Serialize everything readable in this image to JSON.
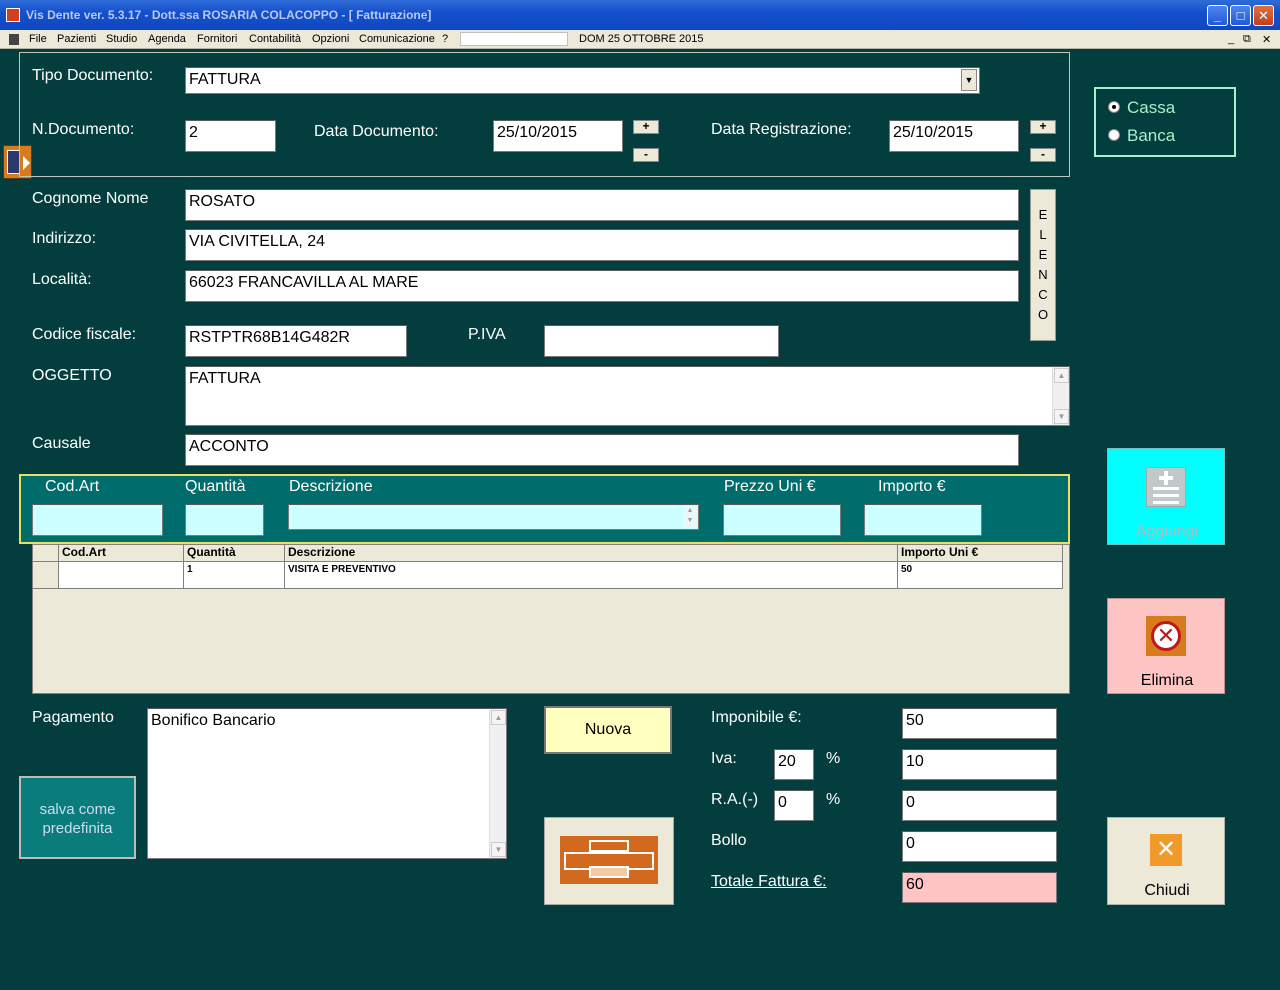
{
  "window": {
    "title": "Vis Dente ver. 5.3.17 - Dott.ssa ROSARIA COLACOPPO - [ Fatturazione]",
    "controls": {
      "minimize": "_",
      "maximize": "□",
      "close": "✕"
    }
  },
  "menu": {
    "items": [
      "File",
      "Pazienti",
      "Studio",
      "Agenda",
      "Fornitori",
      "Contabilità",
      "Opzioni",
      "Comunicazione",
      "?"
    ],
    "date": "DOM 25 OTTOBRE 2015",
    "mdi": {
      "minimize": "_",
      "restore": "⧉",
      "close": "✕"
    }
  },
  "document": {
    "tipo_label": "Tipo Documento:",
    "tipo_value": "FATTURA",
    "numero_label": "N.Documento:",
    "numero_value": "2",
    "data_doc_label": "Data Documento:",
    "data_doc_value": "25/10/2015",
    "data_reg_label": "Data Registrazione:",
    "data_reg_value": "25/10/2015",
    "plus": "+",
    "minus": "-"
  },
  "payment_mode": {
    "options": [
      "Cassa",
      "Banca"
    ],
    "selected": "Cassa"
  },
  "client": {
    "cognome_label": "Cognome Nome",
    "cognome_value": "ROSATO",
    "indirizzo_label": "Indirizzo:",
    "indirizzo_value": "VIA CIVITELLA, 24",
    "localita_label": "Località:",
    "localita_value": "66023 FRANCAVILLA AL MARE",
    "cf_label": "Codice fiscale:",
    "cf_value": "RSTPTR68B14G482R",
    "piva_label": "P.IVA",
    "piva_value": "",
    "elenco_letters": [
      "E",
      "L",
      "E",
      "N",
      "C",
      "O"
    ]
  },
  "oggetto": {
    "label": "OGGETTO",
    "value": "FATTURA"
  },
  "causale": {
    "label": "Causale",
    "value": "ACCONTO"
  },
  "entry": {
    "headers": [
      "Cod.Art",
      "Quantità",
      "Descrizione",
      "Prezzo Uni €",
      "Importo €"
    ],
    "values": [
      "",
      "",
      "",
      "",
      ""
    ]
  },
  "grid": {
    "headers": [
      "Cod.Art",
      "Quantità",
      "Descrizione",
      "Importo Uni €"
    ],
    "rows": [
      {
        "cod": "",
        "qta": "1",
        "descr": "VISITA E PREVENTIVO",
        "importo": "50"
      }
    ]
  },
  "actions": {
    "aggiungi": "Aggiungi",
    "elimina": "Elimina",
    "chiudi": "Chiudi",
    "nuova": "Nuova",
    "salva_line1": "salva come",
    "salva_line2": "predefinita"
  },
  "pagamento": {
    "label": "Pagamento",
    "value": "Bonifico Bancario"
  },
  "totals": {
    "imponibile_label": "Imponibile €:",
    "imponibile_value": "50",
    "iva_label": "Iva:",
    "iva_pct": "20",
    "iva_value": "10",
    "ra_label": "R.A.(-)",
    "ra_pct": "0",
    "ra_value": "0",
    "pct_symbol": "%",
    "bollo_label": "Bollo",
    "bollo_value": "0",
    "totale_label": "Totale Fattura €:",
    "totale_value": "60"
  },
  "colors": {
    "background": "#033d3d",
    "entry_panel": "#006c6c",
    "aggiungi": "#00ffff",
    "elimina": "#ffc4c4",
    "print_icon": "#d2691e"
  }
}
